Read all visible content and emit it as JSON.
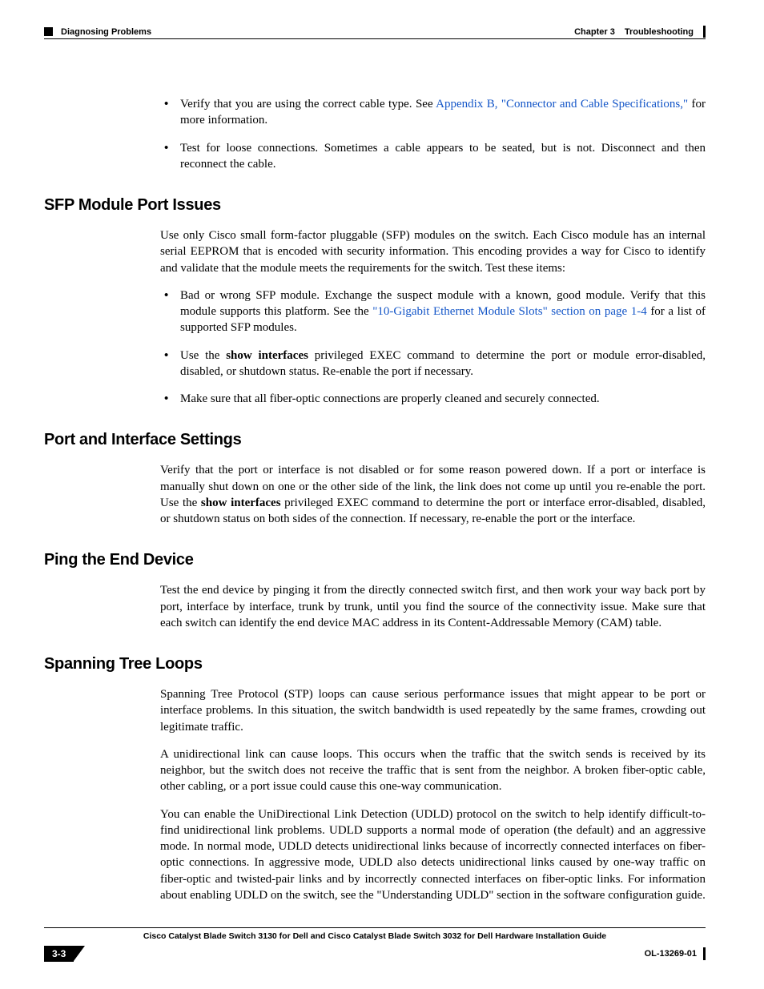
{
  "header": {
    "section": "Diagnosing Problems",
    "chapter_label": "Chapter 3",
    "chapter_title": "Troubleshooting"
  },
  "intro_bullets": [
    {
      "pre": "Verify that you are using the correct cable type. See ",
      "link": "Appendix B, \"Connector and Cable Specifications,\"",
      "post": " for more information."
    },
    {
      "text": "Test for loose connections. Sometimes a cable appears to be seated, but is not. Disconnect and then reconnect the cable."
    }
  ],
  "sfp": {
    "heading": "SFP Module Port Issues",
    "para": "Use only Cisco small form-factor pluggable (SFP) modules on the switch. Each Cisco module has an internal serial EEPROM that is encoded with security information. This encoding provides a way for Cisco to identify and validate that the module meets the requirements for the switch. Test these items:",
    "bullets": {
      "b1_pre": "Bad or wrong SFP module. Exchange the suspect module with a known, good module. Verify that this module supports this platform. See the ",
      "b1_link": "\"10-Gigabit Ethernet Module Slots\" section on page 1-4",
      "b1_post": " for a list of supported SFP modules.",
      "b2_pre": "Use the ",
      "b2_bold": "show interfaces",
      "b2_post": " privileged EXEC command to determine the port or module error-disabled, disabled, or shutdown status. Re-enable the port if necessary.",
      "b3": "Make sure that all fiber-optic connections are properly cleaned and securely connected."
    }
  },
  "port": {
    "heading": "Port and Interface Settings",
    "pre": "Verify that the port or interface is not disabled or for some reason powered down. If a port or interface is manually shut down on one or the other side of the link, the link does not come up until you re-enable the port. Use the ",
    "bold": "show interfaces",
    "post": " privileged EXEC command to determine the port or interface error-disabled, disabled, or shutdown status on both sides of the connection. If necessary, re-enable the port or the interface."
  },
  "ping": {
    "heading": "Ping the End Device",
    "para": "Test the end device by pinging it from the directly connected switch first, and then work your way back port by port, interface by interface, trunk by trunk, until you find the source of the connectivity issue. Make sure that each switch can identify the end device MAC address in its Content-Addressable Memory (CAM) table."
  },
  "stp": {
    "heading": "Spanning Tree Loops",
    "p1": "Spanning Tree Protocol (STP) loops can cause serious performance issues that might appear to be port or interface problems. In this situation, the switch bandwidth is used repeatedly by the same frames, crowding out legitimate traffic.",
    "p2": "A unidirectional link can cause loops. This occurs when the traffic that the switch sends is received by its neighbor, but the switch does not receive the traffic that is sent from the neighbor. A broken fiber-optic cable, other cabling, or a port issue could cause this one-way communication.",
    "p3": "You can enable the UniDirectional Link Detection (UDLD) protocol on the switch to help identify difficult-to-find unidirectional link problems. UDLD supports a normal mode of operation (the default) and an aggressive mode. In normal mode, UDLD detects unidirectional links because of incorrectly connected interfaces on fiber-optic connections. In aggressive mode, UDLD also detects unidirectional links caused by one-way traffic on fiber-optic and twisted-pair links and by incorrectly connected interfaces on fiber-optic links. For information about enabling UDLD on the switch, see the \"Understanding UDLD\" section in the software configuration guide."
  },
  "footer": {
    "title": "Cisco Catalyst Blade Switch 3130 for Dell and Cisco Catalyst Blade Switch 3032 for Dell Hardware Installation Guide",
    "page": "3-3",
    "docnum": "OL-13269-01"
  }
}
